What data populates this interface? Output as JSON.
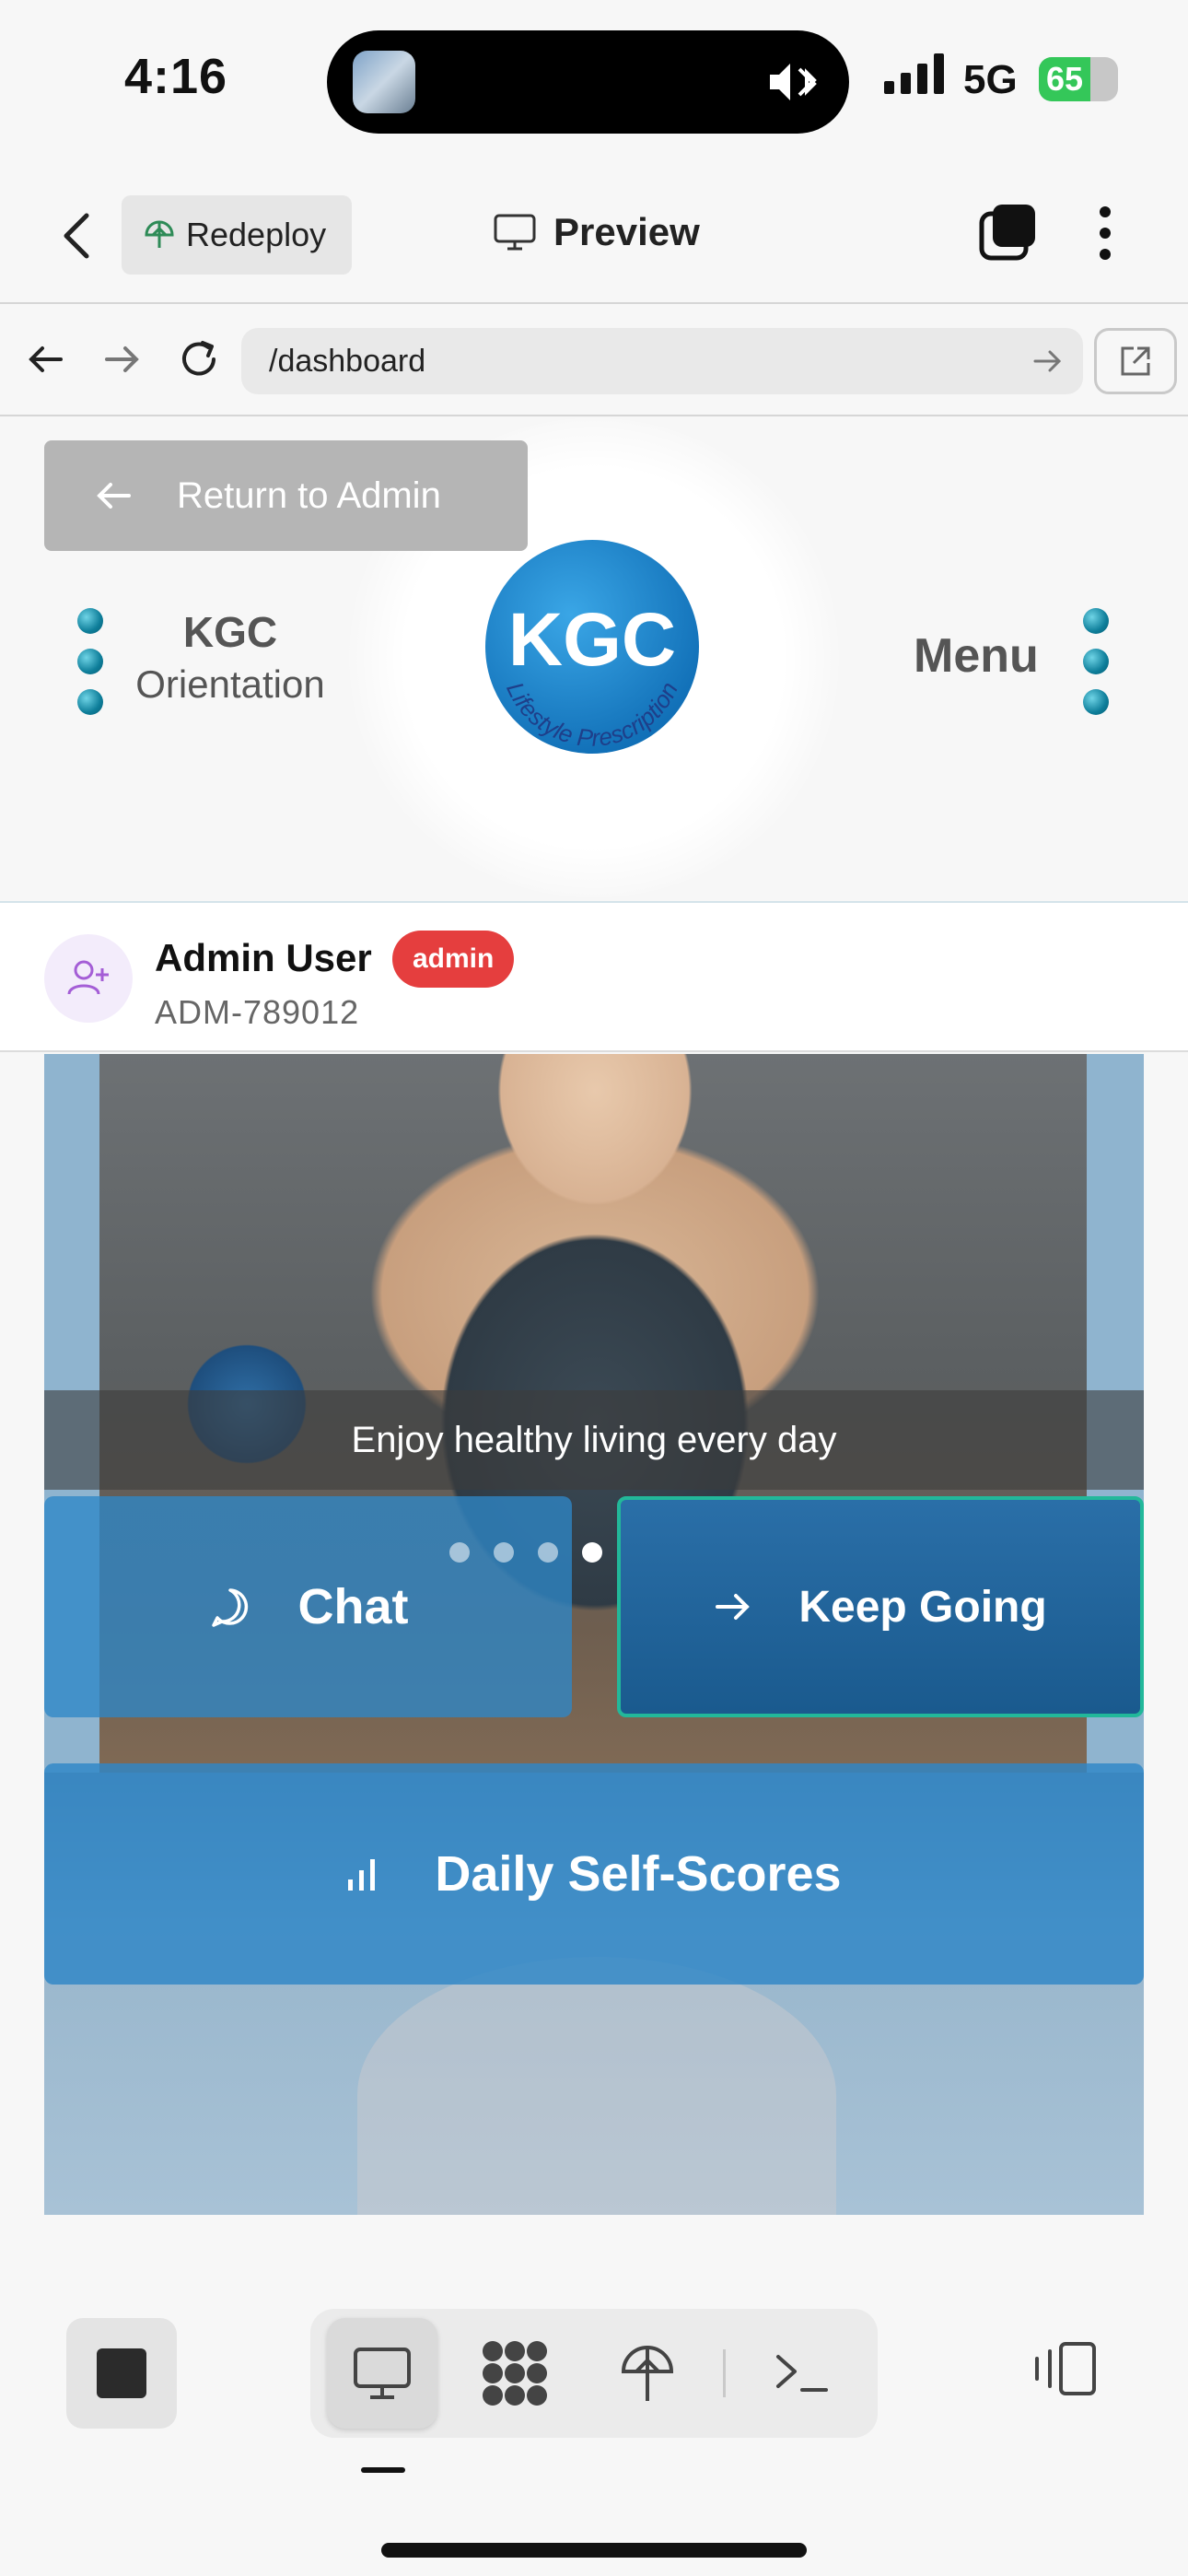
{
  "status_bar": {
    "time": "4:16",
    "network": "5G",
    "battery_level": "65",
    "battery_fraction": 0.65
  },
  "app_toolbar": {
    "redeploy_label": "Redeploy",
    "preview_label": "Preview"
  },
  "browser": {
    "url": "/dashboard"
  },
  "page": {
    "return_label": "Return to Admin",
    "brand_title": "KGC",
    "brand_subtitle": "Orientation",
    "logo_text": "KGC",
    "logo_tagline": "Lifestyle Prescription",
    "menu_label": "Menu",
    "user": {
      "name": "Admin User",
      "role": "admin",
      "id": "ADM-789012"
    },
    "hero": {
      "caption": "Enjoy healthy living every day",
      "slide_count": 4,
      "active_slide": 4
    },
    "actions": {
      "chat_label": "Chat",
      "keep_going_label": "Keep Going",
      "daily_scores_label": "Daily Self-Scores"
    }
  },
  "colors": {
    "accent_blue": "#2e86c7",
    "badge_red": "#e53e3e",
    "redeploy_green": "#2e8b57",
    "keep_going_border": "#22b89a"
  },
  "icons": {
    "back": "chevron-left-icon",
    "redeploy": "umbrella-icon",
    "preview": "monitor-icon",
    "tabs": "tabs-icon",
    "more": "kebab-icon",
    "chat": "chat-bubble-icon",
    "keep_going": "arrow-right-icon",
    "scores": "bar-chart-icon"
  }
}
